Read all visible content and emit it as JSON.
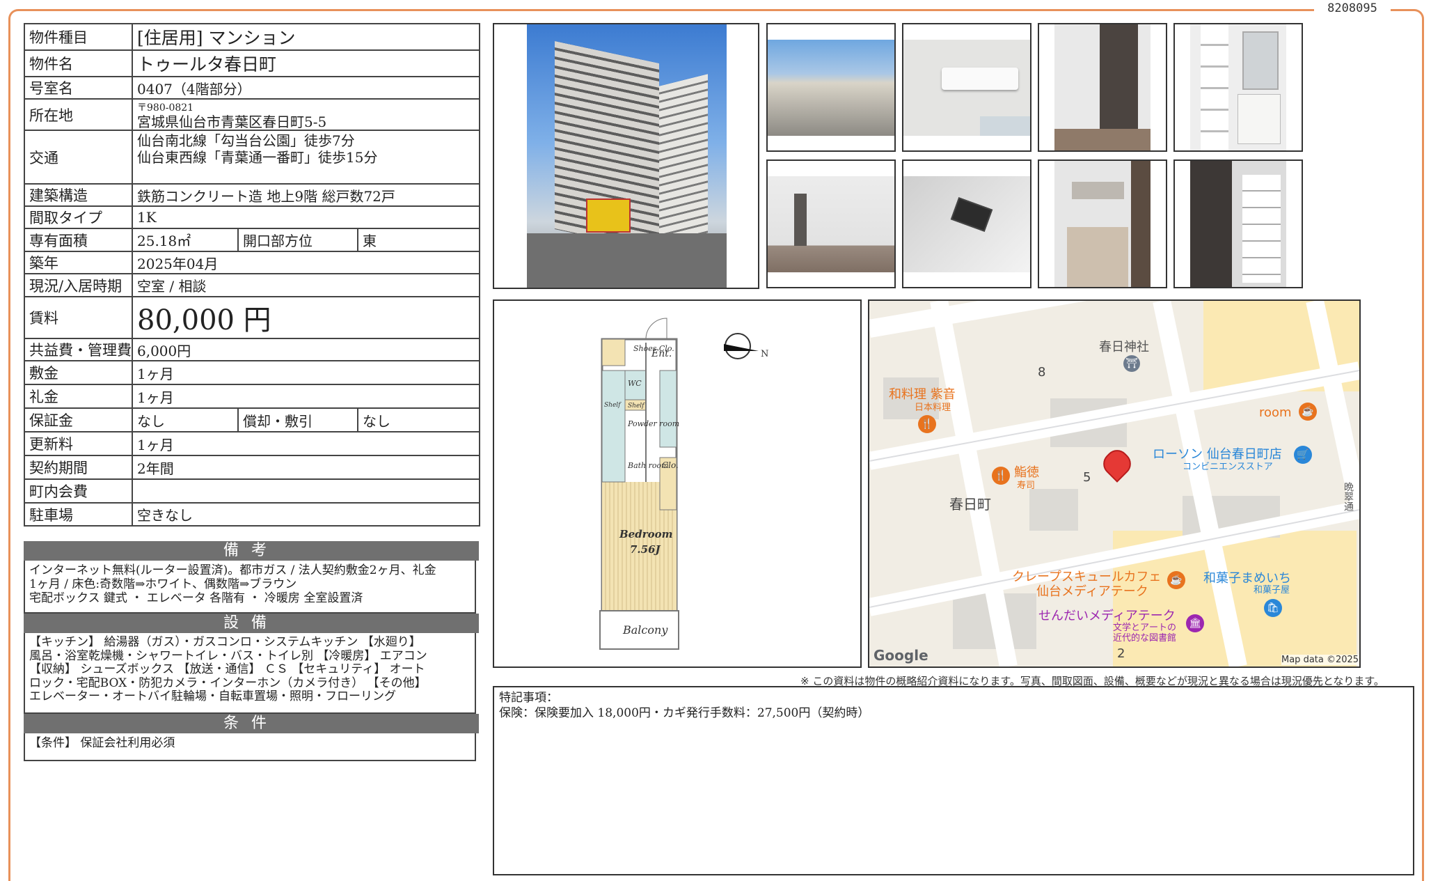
{
  "doc_id": "8208095",
  "spec": {
    "type_label": "物件種目",
    "type_value": "[住居用] マンション",
    "name_label": "物件名",
    "name_value": "トゥールタ春日町",
    "room_label": "号室名",
    "room_value": "0407（4階部分）",
    "addr_label": "所在地",
    "addr_zip": "〒980-0821",
    "addr_value": "宮城県仙台市青葉区春日町5-5",
    "transit_label": "交通",
    "transit_1": "仙台南北線「勾当台公園」徒歩7分",
    "transit_2": "仙台東西線「青葉通一番町」徒歩15分",
    "structure_label": "建築構造",
    "structure_value": "鉄筋コンクリート造 地上9階 総戸数72戸",
    "layout_label": "間取タイプ",
    "layout_value": "1K",
    "area_label": "専有面積",
    "area_value": "25.18㎡",
    "direction_label": "開口部方位",
    "direction_value": "東",
    "built_label": "築年",
    "built_value": "2025年04月",
    "status_label": "現況/入居時期",
    "status_value": "空室 / 相談",
    "rent_label": "賃料",
    "rent_value": "80,000 円",
    "fee_label": "共益費・管理費",
    "fee_value": "6,000円",
    "deposit_label": "敷金",
    "deposit_value": "1ヶ月",
    "key_label": "礼金",
    "key_value": "1ヶ月",
    "guarantee_label": "保証金",
    "guarantee_value": "なし",
    "amort_label": "償却・敷引",
    "amort_value": "なし",
    "renewal_label": "更新料",
    "renewal_value": "1ヶ月",
    "contract_label": "契約期間",
    "contract_value": "2年間",
    "town_label": "町内会費",
    "town_value": "",
    "parking_label": "駐車場",
    "parking_value": "空きなし"
  },
  "sections": {
    "remarks_title": "備考",
    "remarks_text": "インターネット無料(ルーター設置済)。都市ガス / 法人契約敷金2ヶ月、礼金\n1ヶ月 / 床色:奇数階⇒ホワイト、偶数階⇒ブラウン\n宅配ボックス 鍵式 ・ エレベータ 各階有 ・ 冷暖房 全室設置済",
    "equip_title": "設備",
    "equip_text": "【キッチン】 給湯器（ガス）・ガスコンロ・システムキッチン 【水廻り】\n風呂・浴室乾燥機・シャワートイレ・バス・トイレ別 【冷暖房】 エアコン\n【収納】 シューズボックス 【放送・通信】 ＣＳ 【セキュリティ】 オート\nロック・宅配BOX・防犯カメラ・インターホン（カメラ付き） 【その他】\nエレベーター・オートバイ駐輪場・自転車置場・照明・フローリング",
    "cond_title": "条件",
    "cond_text": "【条件】 保証会社利用必須"
  },
  "floorplan": {
    "shoes": "Shoes Clo.",
    "ent": "Ent.",
    "wc": "WC",
    "shelf1": "Shelf",
    "shelf2": "Shelf",
    "powder": "Powder room",
    "bath": "Bath room",
    "clo": "Clo.",
    "bedroom": "Bedroom",
    "bedroom_size": "7.56J",
    "balcony": "Balcony",
    "north": "N"
  },
  "map": {
    "shrine": "春日神社",
    "shrine_num": "8",
    "washoku": "和料理 紫音",
    "washoku_sub": "日本料理",
    "room": "room",
    "lawson": "ローソン 仙台春日町店",
    "lawson_sub": "コンビニエンスストア",
    "sushi": "鮨徳",
    "sushi_sub": "寿司",
    "block5": "5",
    "town": "春日町",
    "crepe": "クレープスキュールカフェ",
    "crepe_sub": "仙台メディアテーク",
    "wagashi": "和菓子まめいち",
    "wagashi_sub": "和菓子屋",
    "mediatheque": "せんだいメディアテーク",
    "media_sub1": "文学とアートの",
    "media_sub2": "近代的な図書館",
    "block2": "2",
    "street": "晩翠通",
    "google": "Google",
    "mapdata": "Map data ©2025"
  },
  "disclaimer": "※ この資料は物件の概略紹介資料になります。写真、間取図面、設備、概要などが現況と異なる場合は現況優先となります。",
  "special": {
    "title": "特記事項：",
    "text": "保険：保険要加入 18,000円・カギ発行手数料：27,500円（契約時）"
  },
  "colors": {
    "frame": "#e8915a",
    "section_bg": "#707070",
    "map_road": "#ffffff",
    "map_block": "#f1ede4",
    "map_yellow": "#fbe9b3",
    "poi_orange": "#e8731e",
    "poi_blue": "#2a87d8",
    "pin_red": "#e53935"
  },
  "icons": [
    "compass-icon",
    "shrine-icon",
    "restaurant-icon",
    "cafe-icon",
    "store-icon",
    "shopping-icon",
    "library-icon",
    "map-pin-icon"
  ]
}
